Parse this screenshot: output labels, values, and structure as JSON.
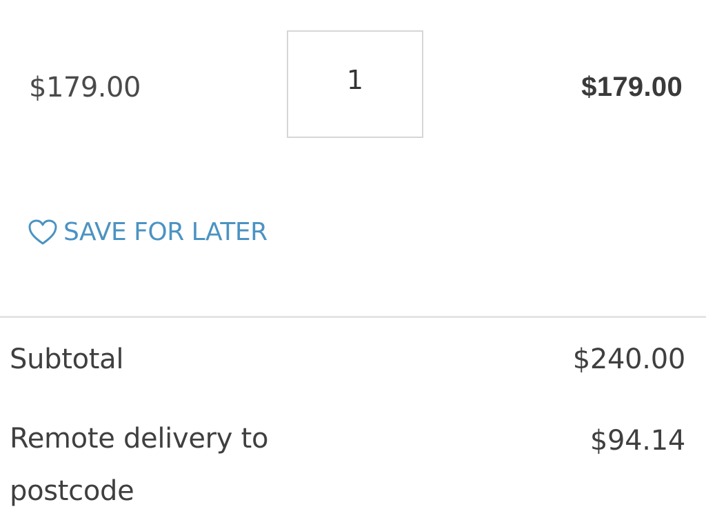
{
  "cart_item": {
    "unit_price": "$179.00",
    "quantity": "1",
    "line_total": "$179.00",
    "save_for_later_label": "SAVE FOR LATER"
  },
  "summary": {
    "subtotal_label": "Subtotal",
    "subtotal_value": "$240.00",
    "delivery_label": "Remote delivery to postcode",
    "delivery_value": "$94.14"
  },
  "icons": {
    "save": "heart-icon"
  },
  "colors": {
    "accent": "#4b93c2",
    "text": "#3f3f3f",
    "divider": "#e4e4e4"
  }
}
